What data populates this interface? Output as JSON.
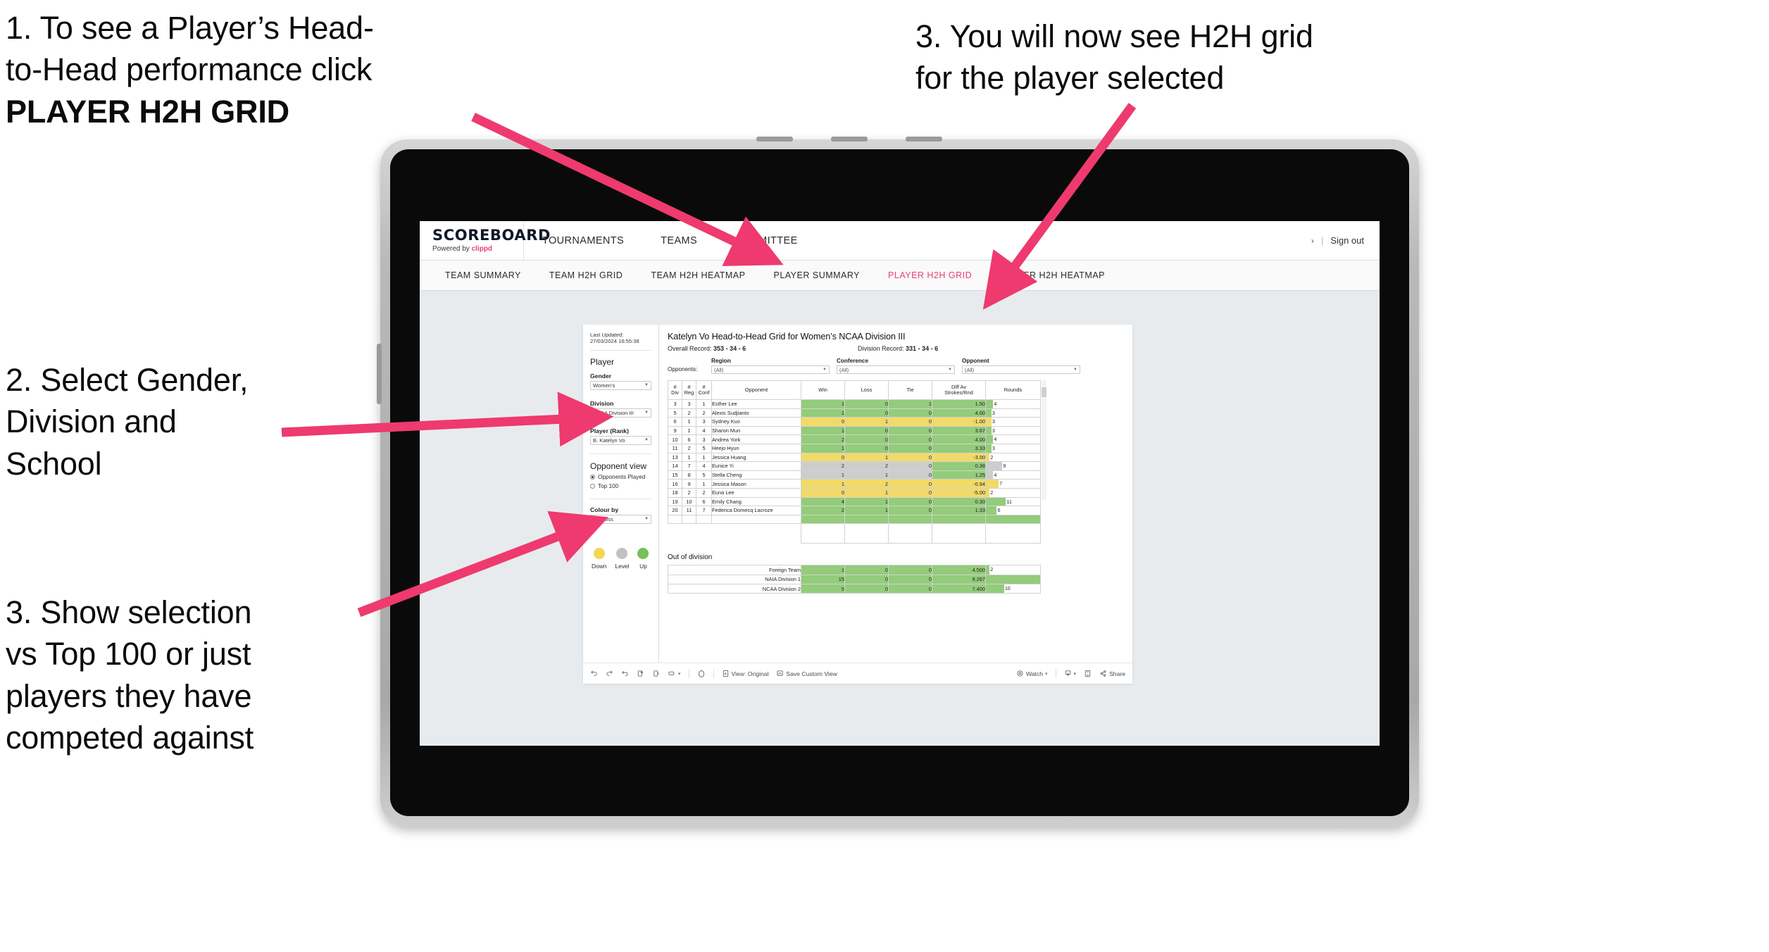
{
  "annotations": {
    "a1_line1": "1. To see a Player’s Head-",
    "a1_line2": "to-Head performance click",
    "a1_bold": "PLAYER H2H GRID",
    "a2_line1": "2. Select Gender,",
    "a2_line2": "Division and",
    "a2_line3": "School",
    "a3_left_line1": "3. Show selection",
    "a3_left_line2": "vs Top 100 or just",
    "a3_left_line3": "players they have",
    "a3_left_line4": "competed against",
    "a3_right_line1": "3. You will now see H2H grid",
    "a3_right_line2": "for the player selected",
    "arrow_color": "#EE3A6E"
  },
  "app": {
    "brand": {
      "title": "SCOREBOARD",
      "powered_prefix": "Powered by ",
      "powered_name": "clippd"
    },
    "top_nav": [
      "TOURNAMENTS",
      "TEAMS",
      "COMMITTEE"
    ],
    "header_right": {
      "chevron": "›",
      "separator": "|",
      "sign_out": "Sign out"
    },
    "sub_nav": [
      {
        "label": "TEAM SUMMARY",
        "active": false
      },
      {
        "label": "TEAM H2H GRID",
        "active": false
      },
      {
        "label": "TEAM H2H HEATMAP",
        "active": false
      },
      {
        "label": "PLAYER SUMMARY",
        "active": false
      },
      {
        "label": "PLAYER H2H GRID",
        "active": true
      },
      {
        "label": "PLAYER H2H HEATMAP",
        "active": false
      }
    ],
    "accent": "#E8436E"
  },
  "filters": {
    "last_updated": "Last Updated: 27/03/2024 16:55:38",
    "player_section_title": "Player",
    "gender": {
      "label": "Gender",
      "value": "Women's"
    },
    "division": {
      "label": "Division",
      "value": "NCAA Division III"
    },
    "player_rank": {
      "label": "Player (Rank)",
      "value": "B. Katelyn Vo"
    },
    "opponent_view": {
      "title": "Opponent view",
      "options": [
        {
          "label": "Opponents Played",
          "selected": true
        },
        {
          "label": "Top 100",
          "selected": false
        }
      ]
    },
    "colour_by": {
      "label": "Colour by",
      "value": "Win/loss"
    },
    "legend": [
      {
        "label": "Down",
        "color": "#F0D755"
      },
      {
        "label": "Level",
        "color": "#BFC3C6"
      },
      {
        "label": "Up",
        "color": "#77C05A"
      }
    ]
  },
  "viz": {
    "title": "Katelyn Vo Head-to-Head Grid for Women’s NCAA Division III",
    "overall_record_label": "Overall Record:",
    "overall_record_value": "353 -  34 - 6",
    "division_record_label": "Division Record:",
    "division_record_value": "331 -  34 - 6",
    "opponents_label": "Opponents:",
    "opponent_filters": [
      {
        "caption": "Region",
        "value": "(All)"
      },
      {
        "caption": "Conference",
        "value": "(All)"
      },
      {
        "caption": "Opponent",
        "value": "(All)"
      }
    ],
    "columns": [
      "#\nDiv",
      "#\nReg",
      "#\nConf",
      "Opponent",
      "Win",
      "Loss",
      "Tie",
      "Diff Av\nStrokes/Rnd",
      "Rounds"
    ],
    "column_labels": {
      "div_l1": "#",
      "div_l2": "Div",
      "reg_l1": "#",
      "reg_l2": "Reg",
      "conf_l1": "#",
      "conf_l2": "Conf",
      "opponent": "Opponent",
      "win": "Win",
      "loss": "Loss",
      "tie": "Tie",
      "diff_l1": "Diff Av",
      "diff_l2": "Strokes/Rnd",
      "rounds": "Rounds"
    },
    "out_of_division_title": "Out of division"
  },
  "chart_data": {
    "type": "table",
    "title": "Katelyn Vo Head-to-Head Grid for Women’s NCAA Division III",
    "colors": {
      "up": "#93CC7A",
      "down": "#F2DA68",
      "level": "#CDCDCD",
      "rounds_bar": "#93CC7A"
    },
    "columns": [
      "#Div",
      "#Reg",
      "#Conf",
      "Opponent",
      "Win",
      "Loss",
      "Tie",
      "Diff Av Strokes/Rnd",
      "Rounds"
    ],
    "rows": [
      {
        "div": "3",
        "reg": "3",
        "conf": "1",
        "opponent": "Esther Lee",
        "win": "1",
        "loss": "0",
        "tie": "1",
        "diff": "1.50",
        "rounds": "4",
        "state": "up",
        "rounds_val": 4
      },
      {
        "div": "5",
        "reg": "2",
        "conf": "2",
        "opponent": "Alexis Sudjianto",
        "win": "1",
        "loss": "0",
        "tie": "0",
        "diff": "4.00",
        "rounds": "3",
        "state": "up",
        "rounds_val": 3
      },
      {
        "div": "6",
        "reg": "1",
        "conf": "3",
        "opponent": "Sydney Kuo",
        "win": "0",
        "loss": "1",
        "tie": "0",
        "diff": "-1.00",
        "rounds": "3",
        "state": "down",
        "rounds_val": 3
      },
      {
        "div": "9",
        "reg": "1",
        "conf": "4",
        "opponent": "Sharon Mun",
        "win": "1",
        "loss": "0",
        "tie": "0",
        "diff": "3.67",
        "rounds": "3",
        "state": "up",
        "rounds_val": 3
      },
      {
        "div": "10",
        "reg": "6",
        "conf": "3",
        "opponent": "Andrea York",
        "win": "2",
        "loss": "0",
        "tie": "0",
        "diff": "4.00",
        "rounds": "4",
        "state": "up",
        "rounds_val": 4
      },
      {
        "div": "11",
        "reg": "2",
        "conf": "5",
        "opponent": "Heejo Hyun",
        "win": "1",
        "loss": "0",
        "tie": "0",
        "diff": "3.33",
        "rounds": "3",
        "state": "up",
        "rounds_val": 3
      },
      {
        "div": "13",
        "reg": "1",
        "conf": "1",
        "opponent": "Jessica Huang",
        "win": "0",
        "loss": "1",
        "tie": "0",
        "diff": "-3.00",
        "rounds": "2",
        "state": "down",
        "rounds_val": 2
      },
      {
        "div": "14",
        "reg": "7",
        "conf": "4",
        "opponent": "Eunice Yi",
        "win": "2",
        "loss": "2",
        "tie": "0",
        "diff": "0.38",
        "rounds": "9",
        "state": "level",
        "rounds_val": 9
      },
      {
        "div": "15",
        "reg": "8",
        "conf": "5",
        "opponent": "Stella Cheng",
        "win": "1",
        "loss": "1",
        "tie": "0",
        "diff": "1.25",
        "rounds": "4",
        "state": "level",
        "rounds_val": 4
      },
      {
        "div": "16",
        "reg": "9",
        "conf": "1",
        "opponent": "Jessica Mason",
        "win": "1",
        "loss": "2",
        "tie": "0",
        "diff": "-0.94",
        "rounds": "7",
        "state": "down",
        "rounds_val": 7
      },
      {
        "div": "18",
        "reg": "2",
        "conf": "2",
        "opponent": "Euna Lee",
        "win": "0",
        "loss": "1",
        "tie": "0",
        "diff": "-5.00",
        "rounds": "2",
        "state": "down",
        "rounds_val": 2
      },
      {
        "div": "19",
        "reg": "10",
        "conf": "6",
        "opponent": "Emily Chang",
        "win": "4",
        "loss": "1",
        "tie": "0",
        "diff": "0.30",
        "rounds": "11",
        "state": "up",
        "rounds_val": 11
      },
      {
        "div": "20",
        "reg": "11",
        "conf": "7",
        "opponent": "Federica Domecq Lacroze",
        "win": "2",
        "loss": "1",
        "tie": "0",
        "diff": "1.33",
        "rounds": "6",
        "state": "up",
        "rounds_val": 6
      }
    ],
    "out_of_division": [
      {
        "name": "Foreign Team",
        "win": "1",
        "loss": "0",
        "tie": "0",
        "diff": "4.500",
        "rounds": "2",
        "state": "up",
        "rounds_val": 2
      },
      {
        "name": "NAIA Division 1",
        "win": "15",
        "loss": "0",
        "tie": "0",
        "diff": "9.267",
        "rounds": "30",
        "state": "up",
        "rounds_val": 30
      },
      {
        "name": "NCAA Division 2",
        "win": "5",
        "loss": "0",
        "tie": "0",
        "diff": "7.400",
        "rounds": "10",
        "state": "up",
        "rounds_val": 10
      }
    ],
    "rounds_max": 30
  },
  "toolbar": {
    "view_label": "View: Original",
    "save_label": "Save Custom View",
    "watch_label": "Watch",
    "share_label": "Share",
    "caret": "▾"
  }
}
